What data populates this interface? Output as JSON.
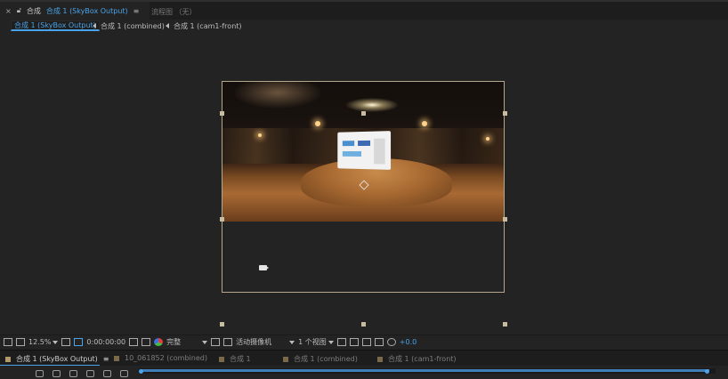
{
  "tab": {
    "close": "×",
    "label": "合成",
    "name": "合成 1 (SkyBox Output)",
    "menu": "≡",
    "flow": "流程图 （无）"
  },
  "breadcrumbs": [
    {
      "label": "合成 1 (SkyBox Output)"
    },
    {
      "label": "合成 1 (combined)"
    },
    {
      "label": "合成 1 (cam1-front)"
    }
  ],
  "toolbar": {
    "zoom": "12.5%",
    "timecode": "0:00:00:00",
    "resolution": "完整",
    "camera": "活动摄像机",
    "views": "1 个视图",
    "exposure": "+0.0"
  },
  "timeline_tabs": [
    {
      "label": "合成 1 (SkyBox Output)",
      "menu": "≡"
    },
    {
      "label": "10_061852 (combined)"
    },
    {
      "label": "合成 1"
    },
    {
      "label": "合成 1 (combined)"
    },
    {
      "label": "合成 1 (cam1-front)"
    }
  ],
  "timeline": {
    "work_area_fraction": 0.99
  },
  "colors": {
    "accent": "#4aa3e8",
    "layer_swatch": "#b49a6a",
    "comp_border": "#b4a88b"
  }
}
